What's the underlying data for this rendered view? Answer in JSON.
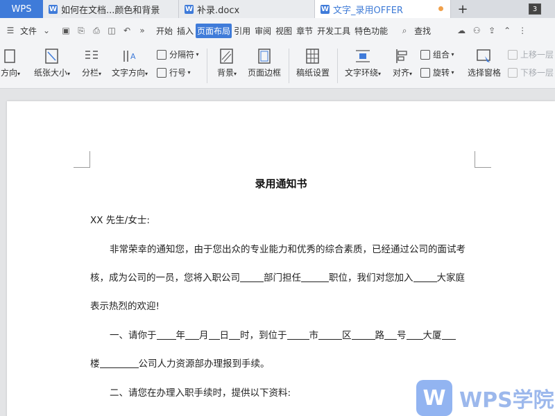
{
  "titlebar": {
    "app": "WPS",
    "tabs": [
      {
        "label": "如何在文档...颜色和背景"
      },
      {
        "label": "补录.docx"
      },
      {
        "label": "文字_录用OFFER"
      }
    ],
    "window_count": "3"
  },
  "menubar": {
    "file": "文件",
    "items": [
      "开始",
      "插入",
      "页面布局",
      "引用",
      "审阅",
      "视图",
      "章节",
      "开发工具",
      "特色功能"
    ],
    "active": "页面布局",
    "search": "查找"
  },
  "ribbon": {
    "orientation": "方向",
    "paper_size": "纸张大小",
    "columns": "分栏",
    "text_direction": "文字方向",
    "separator": "分隔符",
    "line_number": "行号",
    "background": "背景",
    "page_border": "页面边框",
    "manuscript": "稿纸设置",
    "text_wrap": "文字环绕",
    "align": "对齐",
    "group": "组合",
    "rotate": "旋转",
    "selection_pane": "选择窗格",
    "bring_forward": "上移一层",
    "send_backward": "下移一层"
  },
  "document": {
    "title": "录用通知书",
    "salutation": "XX 先生/女士:",
    "p1_a": "非常荣幸的通知您，由于您出众的专业能力和优秀的综合素质，已经通过公司的面试考",
    "p1_b1": "核，成为公司的一员，您将入职公司",
    "p1_b2": "部门担任",
    "p1_b3": "职位，我们对您加入",
    "p1_b4": "大家庭",
    "p1_c": "表示热烈的欢迎!",
    "p2_a1": "一、请你于",
    "p2_a2": "年",
    "p2_a3": "月",
    "p2_a4": "日",
    "p2_a5": "时，到位于",
    "p2_a6": "市",
    "p2_a7": "区",
    "p2_a8": "路",
    "p2_a9": "号",
    "p2_a10": "大厦",
    "p2_b1": "楼",
    "p2_b2": "公司人力资源部办理报到手续。",
    "p3": "二、请您在办理入职手续时，提供以下资料:"
  },
  "watermark": {
    "logo_letter": "W",
    "text": "WPS学院"
  }
}
